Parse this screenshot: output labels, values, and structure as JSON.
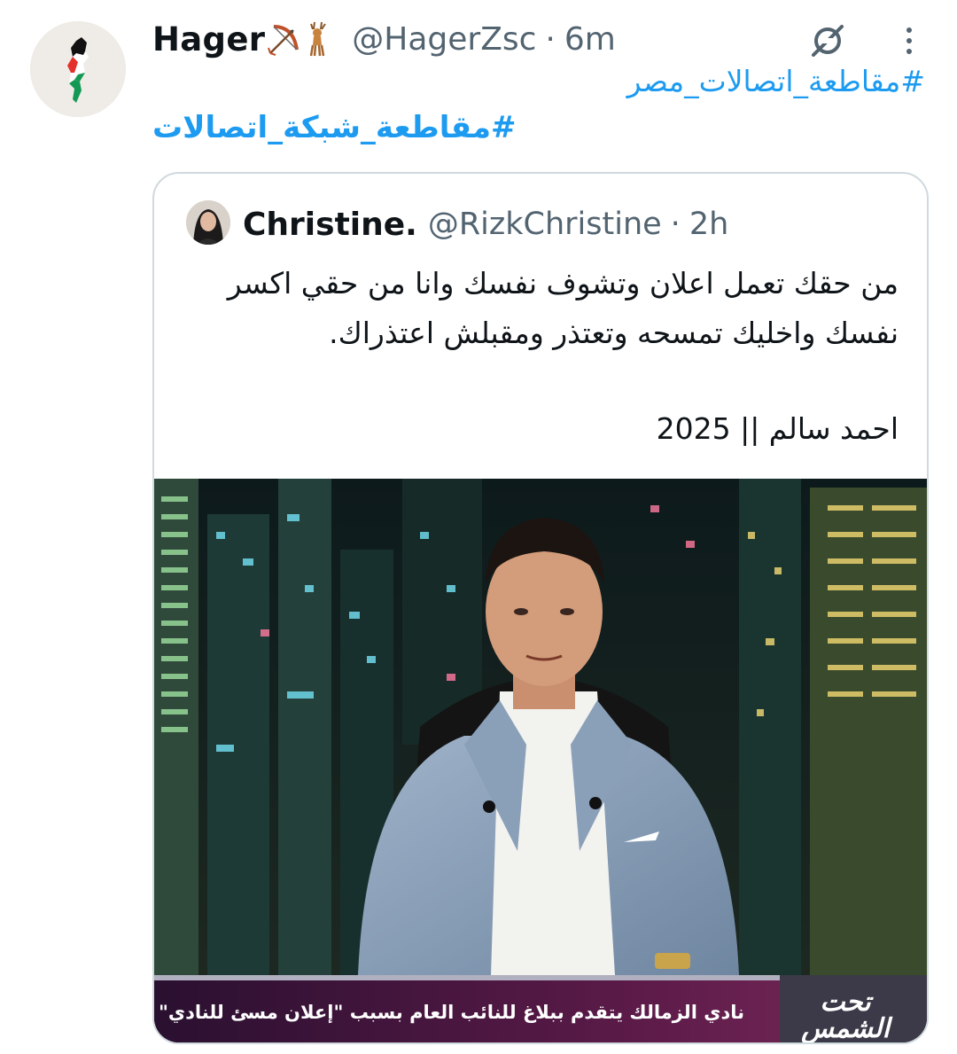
{
  "post": {
    "display_name": "Hager",
    "handle": "@HagerZsc",
    "separator": "·",
    "time": "6m",
    "hashtags": [
      "#مقاطعة_اتصالات_مصر",
      "#مقاطعة_شبكة_اتصالات"
    ],
    "icons": {
      "avatar": "palestine-map-avatar",
      "emoji_1": "bow-and-arrow-icon",
      "emoji_2": "deer-icon",
      "grok": "grok-icon",
      "more": "more-options-icon"
    }
  },
  "quoted": {
    "display_name": "Christine.",
    "handle": "@RizkChristine",
    "separator": "·",
    "time": "2h",
    "text_lines": [
      "من حقك تعمل اعلان وتشوف نفسك وانا من حقي اكسر",
      "نفسك واخليك تمسحه وتعتذر ومقبلش اعتذراك.",
      "احمد سالم || 2025"
    ],
    "media": {
      "caption": "نادي الزمالك يتقدم ببلاغ للنائب العام بسبب \"إعلان مسئ للنادي\"",
      "channel_logo": "تحت الشمس"
    }
  },
  "colors": {
    "link": "#1d9bf0",
    "secondary_text": "#536471",
    "primary_text": "#0f1419",
    "border": "#cfd9de"
  }
}
